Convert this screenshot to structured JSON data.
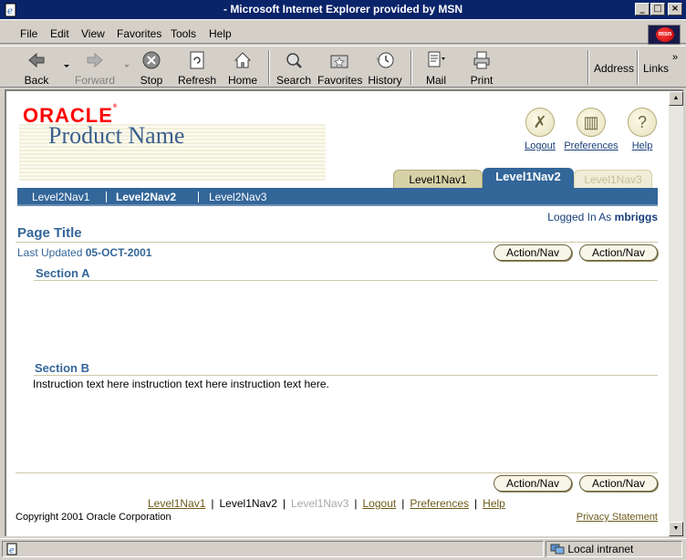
{
  "window": {
    "title": "- Microsoft Internet Explorer provided by MSN",
    "min_label": "_",
    "max_label": "□",
    "close_label": "×"
  },
  "menu": {
    "items": [
      "File",
      "Edit",
      "View",
      "Favorites",
      "Tools",
      "Help"
    ],
    "logo_text": "msn"
  },
  "toolbar": {
    "back": "Back",
    "forward": "Forward",
    "stop": "Stop",
    "refresh": "Refresh",
    "home": "Home",
    "search": "Search",
    "favorites": "Favorites",
    "history": "History",
    "mail": "Mail",
    "print": "Print",
    "address": "Address",
    "links": "Links"
  },
  "header": {
    "oracle": "ORACLE",
    "product_name": "Product Name",
    "global_buttons": [
      {
        "label": "Logout",
        "icon": "logout-icon",
        "glyph": "✗"
      },
      {
        "label": "Preferences",
        "icon": "preferences-icon",
        "glyph": "▥"
      },
      {
        "label": "Help",
        "icon": "help-icon",
        "glyph": "?"
      }
    ]
  },
  "tabs": [
    "Level1Nav1",
    "Level1Nav2",
    "Level1Nav3"
  ],
  "nav2": [
    "Level2Nav1",
    "Level2Nav2",
    "Level2Nav3"
  ],
  "user": {
    "prefix": "Logged In As",
    "name": "mbriggs"
  },
  "page": {
    "title": "Page Title",
    "updated_label": "Last Updated",
    "updated_date": "05-OCT-2001",
    "action_label": "Action/Nav",
    "section_a": "Section A",
    "section_b": "Section B",
    "instruction": "Instruction text here instruction text here instruction text here."
  },
  "footer": {
    "links": [
      "Level1Nav1",
      "Level1Nav2",
      "Level1Nav3",
      "Logout",
      "Preferences",
      "Help"
    ],
    "separator": "|",
    "copyright": "Copyright 2001 Oracle Corporation",
    "privacy": "Privacy Statement"
  },
  "status": {
    "zone": "Local intranet"
  },
  "colors": {
    "nav_blue": "#336699",
    "tab_tan": "#d7d1a7",
    "oracle_red": "#ff0000",
    "titlebar": "#0a246a"
  }
}
